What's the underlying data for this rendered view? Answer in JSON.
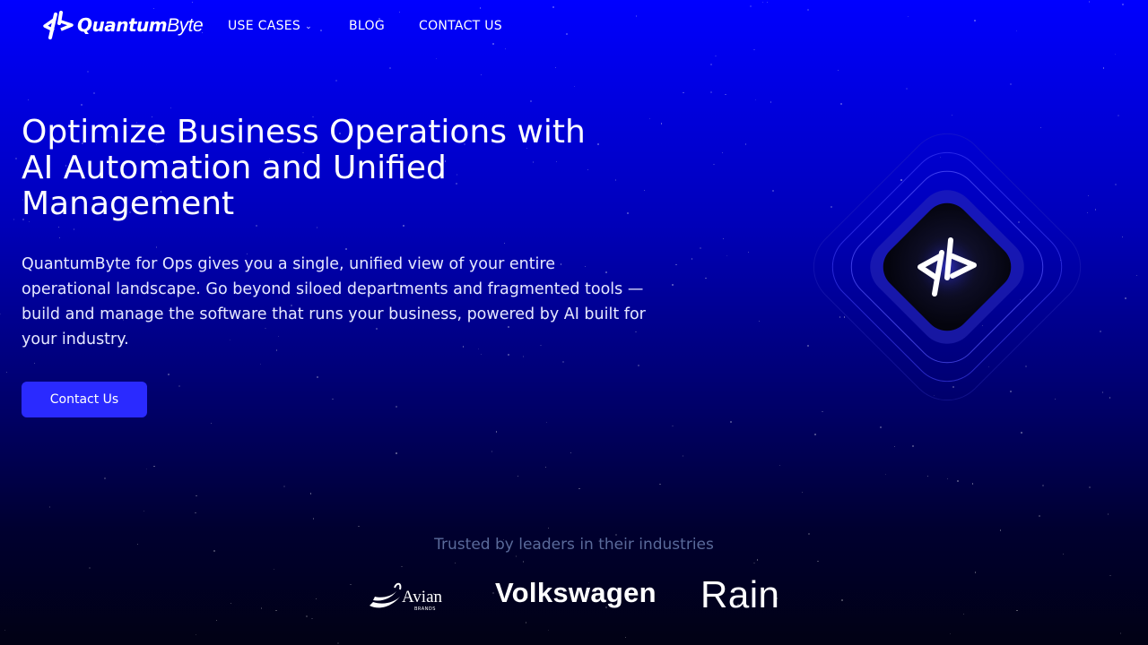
{
  "nav": {
    "logo": {
      "wordmark_bold": "Quantum",
      "wordmark_light": "Byte",
      "icon": "quantumbyte-logo-icon"
    },
    "items": [
      {
        "label": "USE CASES",
        "has_dropdown": true,
        "icon": "chevron-down-icon"
      },
      {
        "label": "BLOG"
      },
      {
        "label": "CONTACT US"
      }
    ]
  },
  "hero": {
    "title": "Optimize Business Operations with AI Automation and Unified Management",
    "description": "QuantumByte for Ops gives you a single, unified view of your entire operational landscape. Go beyond siloed departments and fragmented tools — build and manage the software that runs your business, powered by AI built for your industry.",
    "cta_label": "Contact Us",
    "emblem_icon": "quantumbyte-emblem-icon"
  },
  "trusted": {
    "heading": "Trusted by leaders in their industries",
    "brands": [
      {
        "name": "Avian",
        "tagline": "BRANDS"
      },
      {
        "name": "Volkswagen"
      },
      {
        "name": "Rain"
      }
    ]
  },
  "colors": {
    "background_top": "#0000ff",
    "background_bottom": "#010114",
    "button": "#2a2aff",
    "muted_text": "#5a6a9a"
  }
}
